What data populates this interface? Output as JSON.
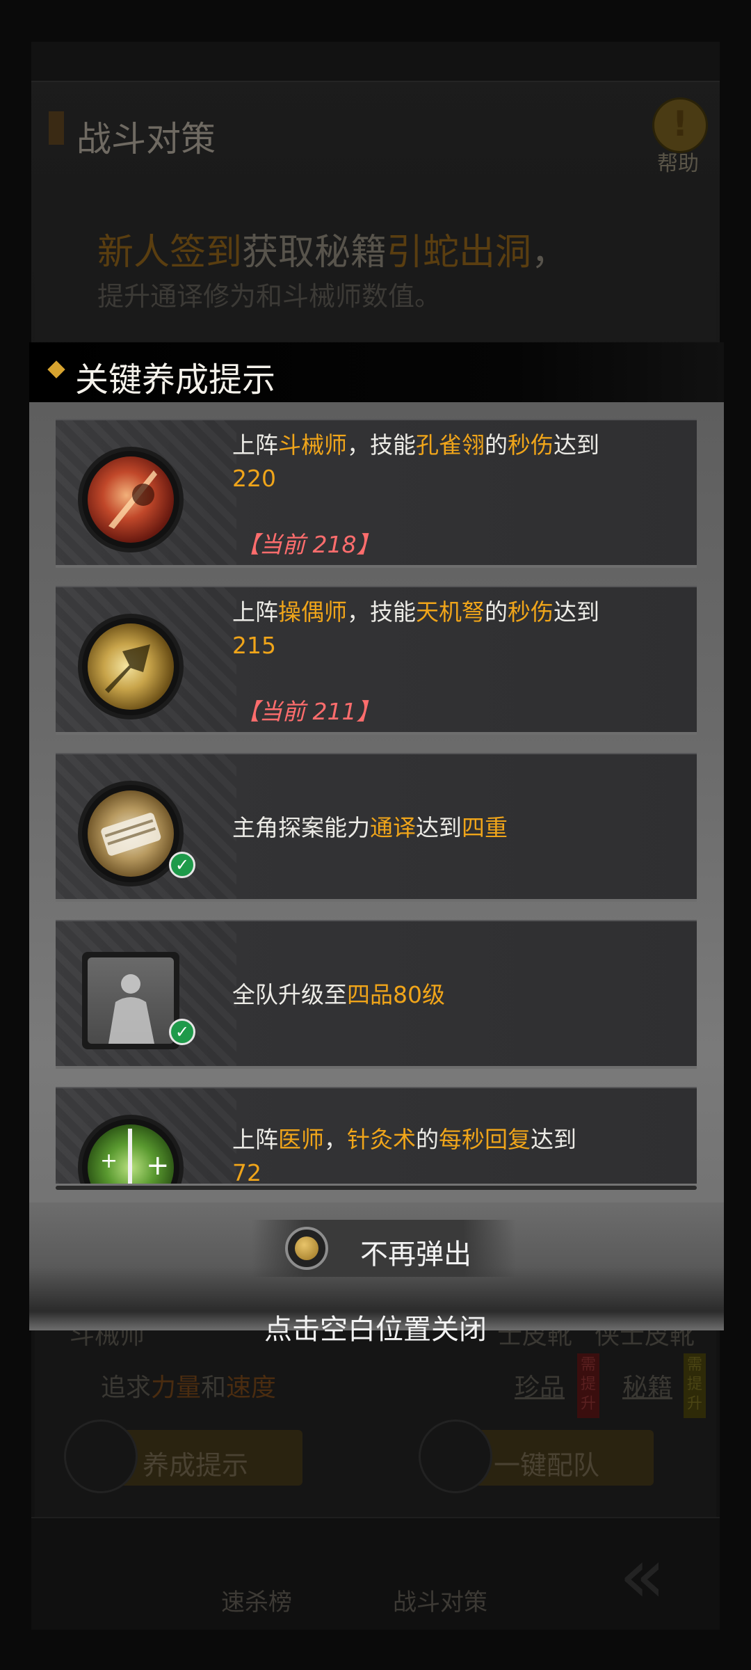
{
  "background": {
    "title": "战斗对策",
    "help_label": "帮助",
    "notice": {
      "line1_hl1": "新人签到",
      "line1_mid": "获取秘籍",
      "line1_hl2": "引蛇出洞",
      "line1_end": "，",
      "line2": "提升通译修为和斗械师数值。"
    },
    "lower": {
      "role": "斗械师",
      "equip1": "士皮靴",
      "equip2": "侠士皮靴",
      "pursue_prefix": "追求",
      "pursue_hl1": "力量",
      "pursue_mid": "和",
      "pursue_hl2": "速度",
      "link1": "珍品",
      "badge1": "需提升",
      "link2": "秘籍",
      "badge2": "需提升",
      "btn_train": "养成提示",
      "btn_team": "一键配队"
    },
    "nav": {
      "item1": "速杀榜",
      "item2": "战斗对策"
    }
  },
  "popup": {
    "title": "关键养成提示",
    "cards": [
      {
        "t1": "上阵",
        "h1": "斗械师",
        "t2": "，技能",
        "h2": "孔雀翎",
        "t3": "的",
        "h3": "秒伤",
        "t4": "达到",
        "target": "220",
        "current": "【当前 218】"
      },
      {
        "t1": "上阵",
        "h1": "操偶师",
        "t2": "，技能",
        "h2": "天机弩",
        "t3": "的",
        "h3": "秒伤",
        "t4": "达到",
        "target": "215",
        "current": "【当前 211】"
      },
      {
        "t1": "主角探案能力",
        "h1": "通译",
        "t2": "达到",
        "h2": "四重",
        "completed": true
      },
      {
        "t1": "全队升级至",
        "h1": "四品80级",
        "completed": true
      },
      {
        "t1": "上阵",
        "h1": "医师",
        "t2": "，",
        "h2": "针灸术",
        "t3": "的",
        "h3": "每秒回复",
        "t4": "达到",
        "target": "72"
      }
    ],
    "dont_show_label": "不再弹出",
    "close_hint": "点击空白位置关闭"
  },
  "colors": {
    "highlight": "#f0a51a",
    "current_value": "#ff6d6d",
    "check": "#1e9a4a"
  }
}
